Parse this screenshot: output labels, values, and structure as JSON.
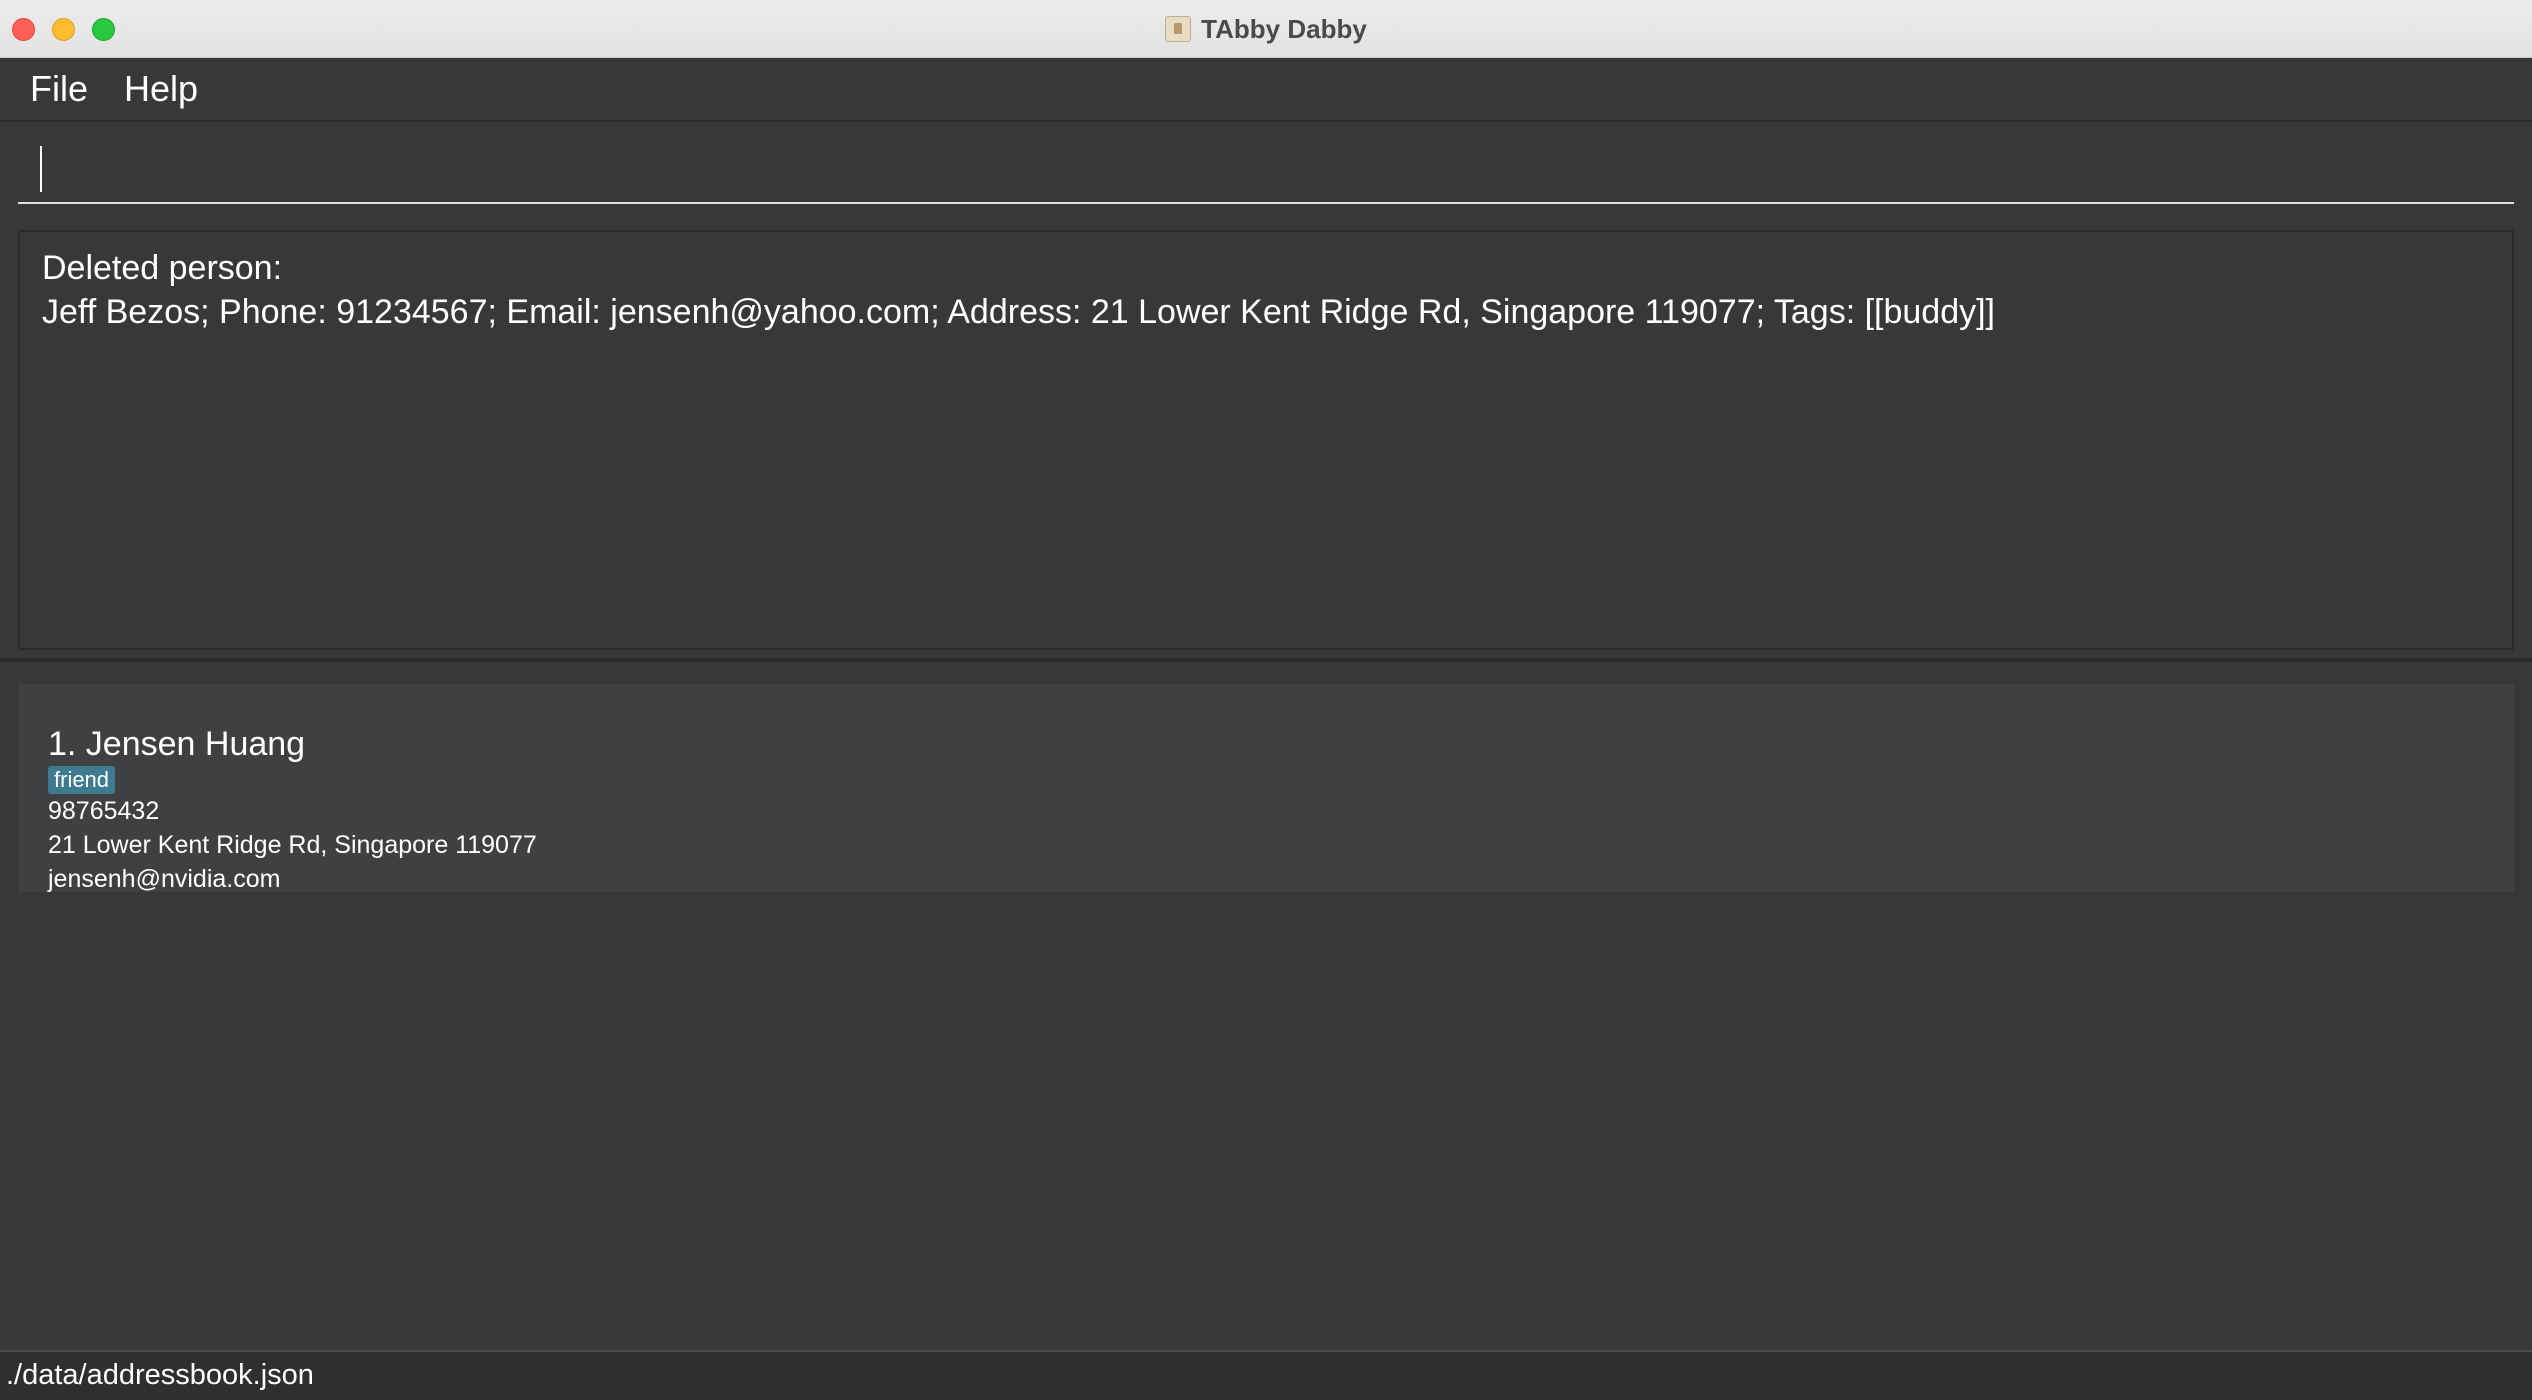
{
  "window": {
    "title": "TAbby Dabby",
    "app_icon": "address-book-icon"
  },
  "menu": {
    "items": [
      {
        "label": "File"
      },
      {
        "label": "Help"
      }
    ]
  },
  "command_box": {
    "value": "",
    "placeholder": ""
  },
  "result_display": {
    "line1": "Deleted person:",
    "line2": "Jeff Bezos; Phone: 91234567; Email: jensenh@yahoo.com; Address: 21 Lower Kent Ridge Rd, Singapore 119077; Tags: [[buddy]]"
  },
  "persons": [
    {
      "index_name": "1. Jensen Huang",
      "tags": [
        "friend"
      ],
      "phone": "98765432",
      "address": "21 Lower Kent Ridge Rd, Singapore 119077",
      "email": "jensenh@nvidia.com"
    }
  ],
  "status_bar": {
    "path": "./data/addressbook.json"
  },
  "colors": {
    "background": "#383838",
    "card": "#3f4042",
    "tag": "#3e7b91",
    "text": "#ffffff"
  }
}
